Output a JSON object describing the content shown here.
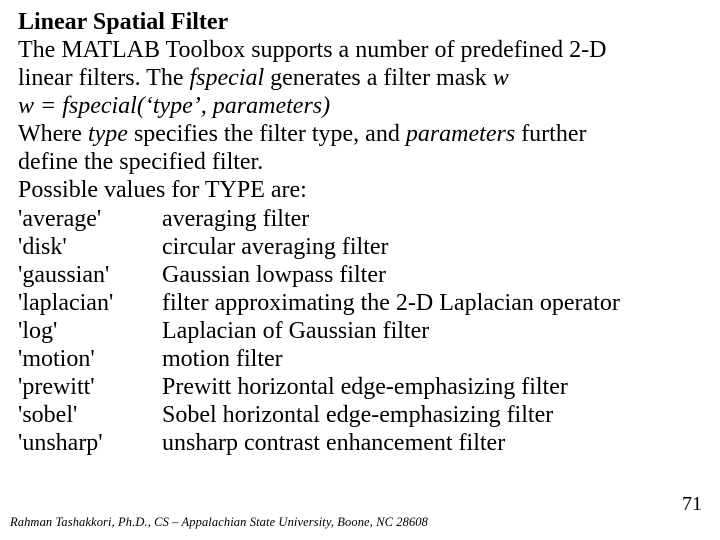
{
  "title": "Linear Spatial Filter",
  "intro_a": "The MATLAB Toolbox supports a number of predefined 2-D",
  "intro_b_pre": "linear filters.  The ",
  "intro_b_em": "fspecial",
  "intro_b_post": " generates a filter mask ",
  "intro_b_w": "w",
  "syntax": "w = fspecial(‘type’, parameters)",
  "where_a": "Where ",
  "where_type": "type",
  "where_b": " specifies the filter type, and ",
  "where_params": "parameters",
  "where_c": " further",
  "where_d": "define the specified filter.",
  "possible": "Possible values for TYPE are:",
  "rows": [
    {
      "k": "'average'",
      "v": "averaging filter"
    },
    {
      "k": "'disk'",
      "v": "circular averaging filter"
    },
    {
      "k": "'gaussian'",
      "v": "Gaussian lowpass filter"
    },
    {
      "k": "'laplacian'",
      "v": "filter approximating the 2-D Laplacian operator"
    },
    {
      "k": "'log'",
      "v": "Laplacian of Gaussian filter"
    },
    {
      "k": "'motion'",
      "v": "motion filter"
    },
    {
      "k": "'prewitt'",
      "v": "Prewitt horizontal edge-emphasizing filter"
    },
    {
      "k": "'sobel'",
      "v": "Sobel horizontal edge-emphasizing filter"
    },
    {
      "k": "'unsharp'",
      "v": "unsharp contrast enhancement filter"
    }
  ],
  "footer": "Rahman Tashakkori, Ph.D., CS – Appalachian State University, Boone, NC 28608",
  "page": "71"
}
